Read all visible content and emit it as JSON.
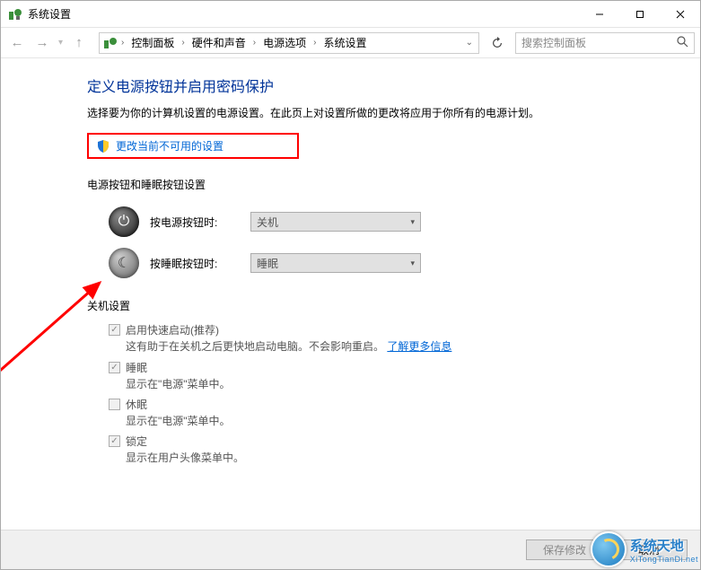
{
  "window": {
    "title": "系统设置"
  },
  "breadcrumb": {
    "items": [
      "控制面板",
      "硬件和声音",
      "电源选项",
      "系统设置"
    ]
  },
  "search": {
    "placeholder": "搜索控制面板"
  },
  "main": {
    "title": "定义电源按钮并启用密码保护",
    "subtitle": "选择要为你的计算机设置的电源设置。在此页上对设置所做的更改将应用于你所有的电源计划。",
    "change_link": "更改当前不可用的设置"
  },
  "button_section": {
    "heading": "电源按钮和睡眠按钮设置",
    "rows": [
      {
        "label": "按电源按钮时:",
        "value": "关机"
      },
      {
        "label": "按睡眠按钮时:",
        "value": "睡眠"
      }
    ]
  },
  "shutdown_section": {
    "heading": "关机设置",
    "items": [
      {
        "label": "启用快速启动(推荐)",
        "desc_prefix": "这有助于在关机之后更快地启动电脑。不会影响重启。",
        "link": "了解更多信息",
        "checked": true
      },
      {
        "label": "睡眠",
        "desc": "显示在\"电源\"菜单中。",
        "checked": true
      },
      {
        "label": "休眠",
        "desc": "显示在\"电源\"菜单中。",
        "checked": false
      },
      {
        "label": "锁定",
        "desc": "显示在用户头像菜单中。",
        "checked": true
      }
    ]
  },
  "footer": {
    "save": "保存修改",
    "cancel": "取消"
  },
  "watermark": {
    "text": "系统天地",
    "sub": "XiTongTianDi.net"
  }
}
